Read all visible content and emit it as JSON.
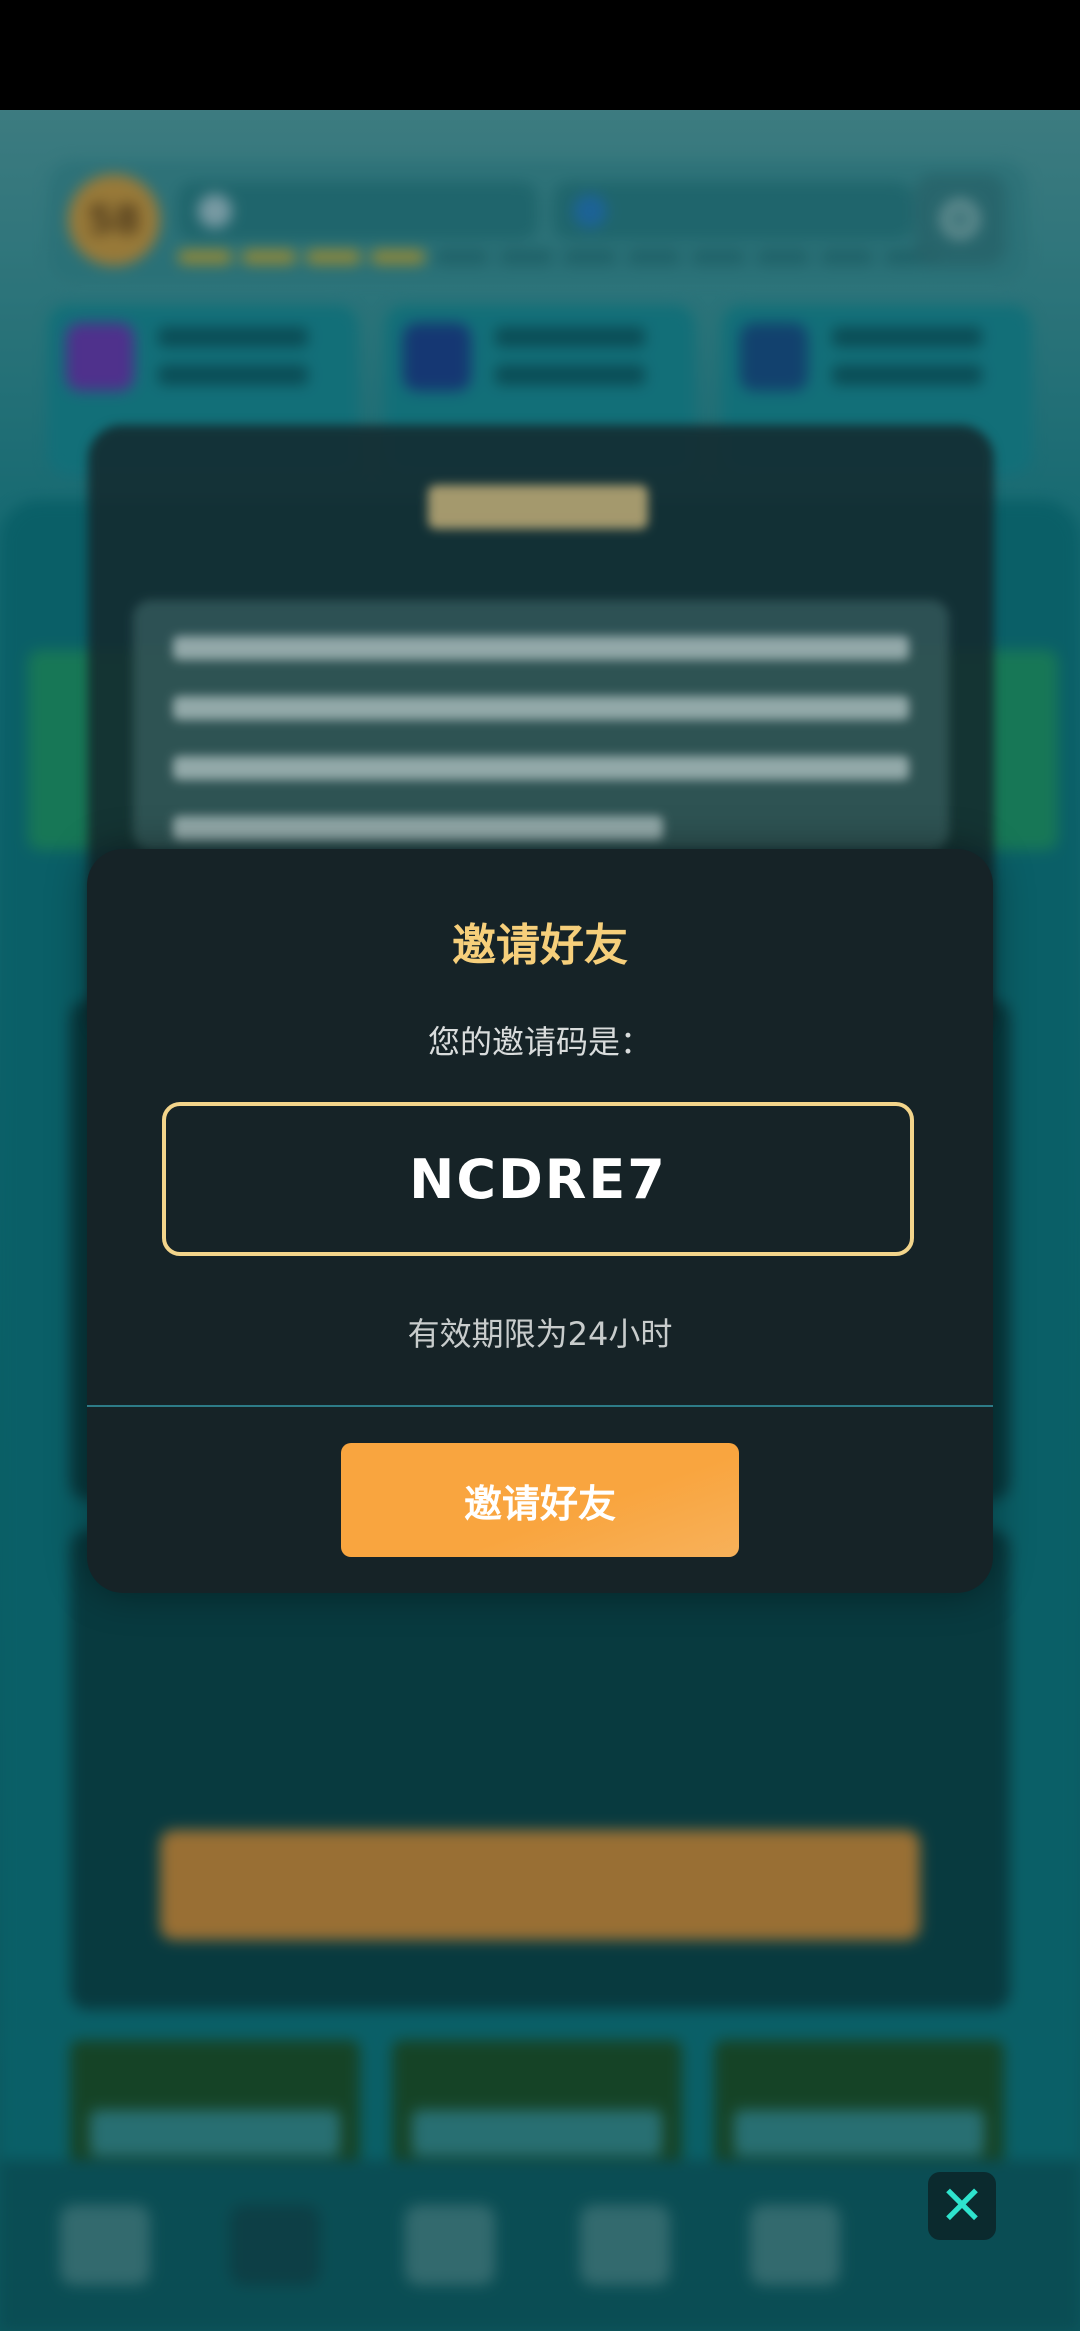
{
  "invite_modal": {
    "title": "邀请好友",
    "code_label": "您的邀请码是：",
    "invite_code": "NCDRE7",
    "validity_note": "有效期限为24小时",
    "invite_button_label": "邀请好友"
  },
  "overlay": {
    "close_icon_glyph": "✕"
  },
  "background_hud": {
    "level_badge": "58",
    "settings_icon_glyph": "⚙"
  },
  "colors": {
    "accent_gold": "#f6cf7b",
    "button_orange": "#f9a53f",
    "modal_bg": "#162327",
    "close_icon_teal": "#2ee3cd"
  }
}
